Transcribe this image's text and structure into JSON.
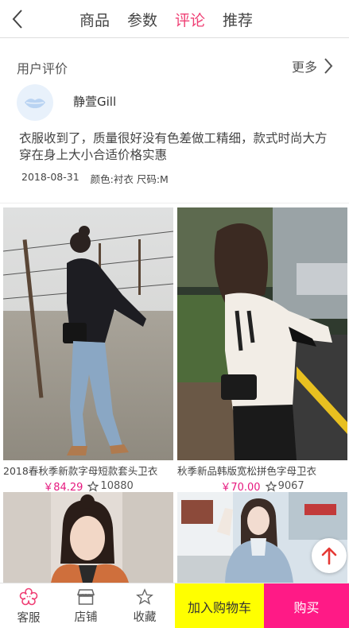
{
  "header": {
    "tabs": [
      {
        "label": "商品",
        "active": false
      },
      {
        "label": "参数",
        "active": false
      },
      {
        "label": "评论",
        "active": true
      },
      {
        "label": "推荐",
        "active": false
      }
    ]
  },
  "reviews": {
    "title": "用户评价",
    "more_label": "更多",
    "user_name": "静萱Gill",
    "text": "衣服收到了，质量很好没有色差做工精细，款式时尚大方穿在身上大小合适价格实惠",
    "date": "2018-08-31",
    "spec": "颜色:衬衣 尺码:M"
  },
  "products": [
    {
      "title": "2018春秋季新款字母短款套头卫衣",
      "price": "￥84.29",
      "favorites": "10880"
    },
    {
      "title": "秋季新品韩版宽松拼色字母卫衣",
      "price": "￥70.00",
      "favorites": "9067"
    }
  ],
  "bottom": {
    "service": "客服",
    "store": "店铺",
    "favorite": "收藏",
    "add_cart": "加入购物车",
    "buy": "购买"
  },
  "colors": {
    "accent": "#ef3f74",
    "price": "#e6197f",
    "cart_button": "#ffff00",
    "buy_button": "#ff1a86"
  }
}
